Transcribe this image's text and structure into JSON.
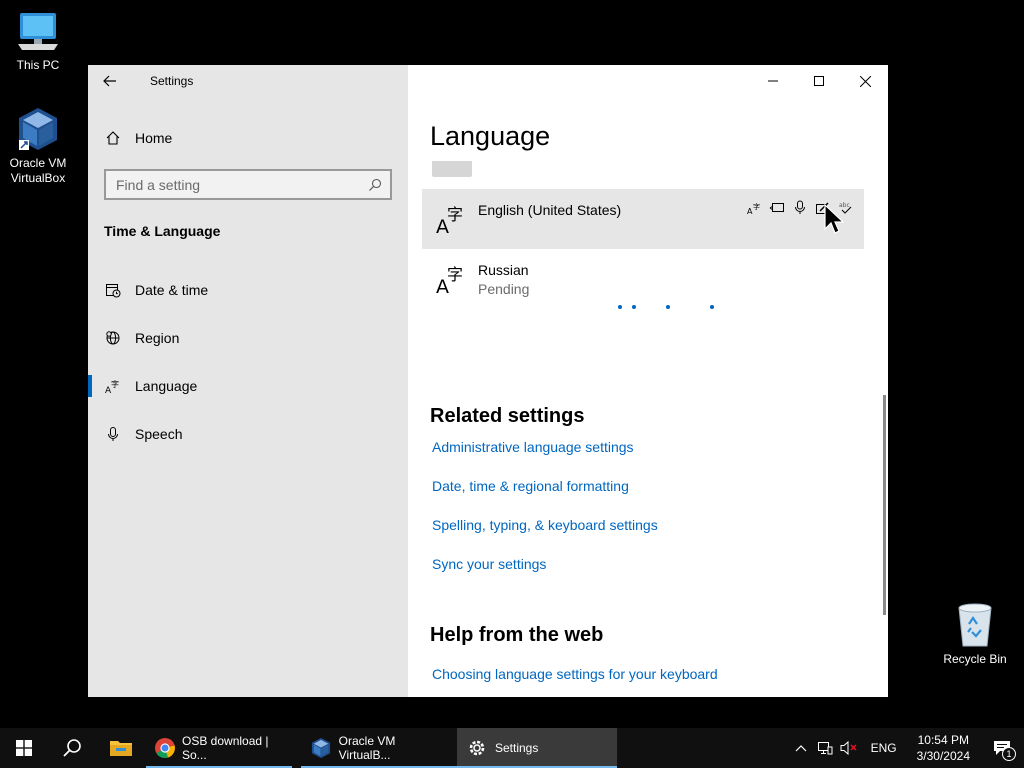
{
  "desktop": {
    "icons": [
      {
        "label": "This PC"
      },
      {
        "label": "Oracle VM VirtualBox"
      }
    ],
    "recycle_bin": {
      "label": "Recycle Bin"
    }
  },
  "window": {
    "title": "Settings",
    "sidebar": {
      "home_label": "Home",
      "search_placeholder": "Find a setting",
      "section_heading": "Time & Language",
      "items": [
        {
          "label": "Date & time",
          "icon": "calendar-clock-icon"
        },
        {
          "label": "Region",
          "icon": "globe-icon"
        },
        {
          "label": "Language",
          "icon": "language-icon",
          "active": true
        },
        {
          "label": "Speech",
          "icon": "microphone-icon"
        }
      ]
    },
    "content": {
      "page_title": "Language",
      "languages": [
        {
          "name": "English (United States)",
          "status": "",
          "selected": true
        },
        {
          "name": "Russian",
          "status": "Pending"
        }
      ],
      "related_heading": "Related settings",
      "related_links": [
        "Administrative language settings",
        "Date, time & regional formatting",
        "Spelling, typing, & keyboard settings",
        "Sync your settings"
      ],
      "help_heading": "Help from the web",
      "help_links": [
        "Choosing language settings for your keyboard"
      ]
    }
  },
  "taskbar": {
    "apps": [
      {
        "label": "OSB download | So...",
        "icon": "chrome-icon",
        "active": false
      },
      {
        "label": "Oracle VM VirtualB...",
        "icon": "virtualbox-icon",
        "active": false
      },
      {
        "label": "Settings",
        "icon": "gear-icon",
        "active": true
      }
    ],
    "tray": {
      "input_language": "ENG",
      "time": "10:54 PM",
      "date": "3/30/2024",
      "notification_count": "1"
    }
  },
  "colors": {
    "accent": "#0067c0",
    "sidebar_bg": "#e6e6e6",
    "taskbar_bg": "#101010"
  }
}
